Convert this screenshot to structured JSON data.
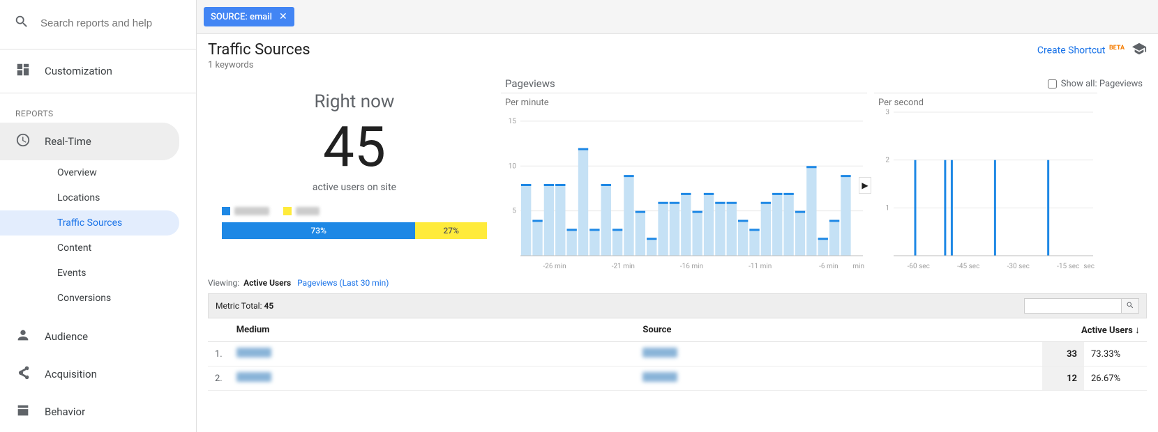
{
  "search": {
    "placeholder": "Search reports and help"
  },
  "sidebar": {
    "customization": "Customization",
    "reports_label": "REPORTS",
    "realtime": "Real-Time",
    "sub": {
      "overview": "Overview",
      "locations": "Locations",
      "traffic_sources": "Traffic Sources",
      "content": "Content",
      "events": "Events",
      "conversions": "Conversions"
    },
    "audience": "Audience",
    "acquisition": "Acquisition",
    "behavior": "Behavior"
  },
  "filter_chip": {
    "label": "SOURCE:",
    "value": "email"
  },
  "title": {
    "heading": "Traffic Sources",
    "sub": "1 keywords"
  },
  "actions": {
    "shortcut": "Create Shortcut",
    "beta": "BETA"
  },
  "rightnow": {
    "label": "Right now",
    "count": "45",
    "sub": "active users on site"
  },
  "split": {
    "a_pct": "73%",
    "b_pct": "27%",
    "a_color": "#1e88e5",
    "b_color": "#ffeb3b"
  },
  "pageviews": {
    "heading": "Pageviews",
    "show_all": "Show all: Pageviews"
  },
  "viewing": {
    "label": "Viewing:",
    "active": "Active Users",
    "alt": "Pageviews (Last 30 min)"
  },
  "metric_total": {
    "label": "Metric Total:",
    "value": "45"
  },
  "table": {
    "cols": {
      "medium": "Medium",
      "source": "Source",
      "active": "Active Users"
    },
    "rows": [
      {
        "idx": "1.",
        "users": "33",
        "pct": "73.33%"
      },
      {
        "idx": "2.",
        "users": "12",
        "pct": "26.67%"
      }
    ]
  },
  "chart_data": [
    {
      "type": "bar",
      "title": "Per minute",
      "xlabel": "min",
      "ylabel": "",
      "ylim": [
        0,
        16
      ],
      "categories": [
        "-30",
        "-29",
        "-28",
        "-27",
        "-26",
        "-25",
        "-24",
        "-23",
        "-22",
        "-21",
        "-20",
        "-19",
        "-18",
        "-17",
        "-16",
        "-15",
        "-14",
        "-13",
        "-12",
        "-11",
        "-10",
        "-9",
        "-8",
        "-7",
        "-6",
        "-5",
        "-4",
        "-3",
        "-2",
        "-1"
      ],
      "x_tick_labels": [
        "-26 min",
        "-21 min",
        "-16 min",
        "-11 min",
        "-6 min"
      ],
      "y_ticks": [
        5,
        10,
        15
      ],
      "series": [
        {
          "name": "pageviews-per-minute",
          "color": "#c5e1f5",
          "values": [
            8,
            4,
            8,
            8,
            3,
            12,
            3,
            8,
            3,
            9,
            5,
            2,
            6,
            6,
            7,
            5,
            7,
            6,
            6,
            4,
            3,
            6,
            7,
            7,
            5,
            10,
            2,
            4,
            9,
            0
          ]
        },
        {
          "name": "cap-marker",
          "color": "#1e88e5",
          "values": [
            8,
            4,
            8,
            8,
            3,
            12,
            3,
            8,
            3,
            9,
            5,
            2,
            6,
            6,
            7,
            5,
            7,
            6,
            6,
            4,
            3,
            6,
            7,
            7,
            5,
            10,
            2,
            4,
            9,
            0
          ]
        }
      ]
    },
    {
      "type": "bar",
      "title": "Per second",
      "xlabel": "sec",
      "ylabel": "",
      "ylim": [
        0,
        3
      ],
      "categories": [
        "-60",
        "-59",
        "-58",
        "-57",
        "-56",
        "-55",
        "-54",
        "-53",
        "-52",
        "-51",
        "-50",
        "-49",
        "-48",
        "-47",
        "-46",
        "-45",
        "-44",
        "-43",
        "-42",
        "-41",
        "-40",
        "-39",
        "-38",
        "-37",
        "-36",
        "-35",
        "-34",
        "-33",
        "-32",
        "-31",
        "-30",
        "-29",
        "-28",
        "-27",
        "-26",
        "-25",
        "-24",
        "-23",
        "-22",
        "-21",
        "-20",
        "-19",
        "-18",
        "-17",
        "-16",
        "-15",
        "-14",
        "-13",
        "-12",
        "-11",
        "-10",
        "-9",
        "-8",
        "-7",
        "-6",
        "-5",
        "-4",
        "-3",
        "-2",
        "-1"
      ],
      "x_tick_labels": [
        "-60 sec",
        "-45 sec",
        "-30 sec",
        "-15 sec"
      ],
      "y_ticks": [
        1,
        2,
        3
      ],
      "series": [
        {
          "name": "pageviews-per-second",
          "color": "#1e88e5",
          "values": [
            0,
            0,
            0,
            0,
            0,
            0,
            2,
            0,
            0,
            0,
            0,
            0,
            0,
            0,
            0,
            2,
            0,
            2,
            0,
            0,
            0,
            0,
            0,
            0,
            0,
            0,
            0,
            0,
            0,
            0,
            2,
            0,
            0,
            0,
            0,
            0,
            0,
            0,
            0,
            0,
            0,
            0,
            0,
            0,
            0,
            0,
            2,
            0,
            0,
            0,
            0,
            0,
            0,
            0,
            0,
            0,
            0,
            0,
            0,
            0
          ]
        }
      ]
    }
  ]
}
